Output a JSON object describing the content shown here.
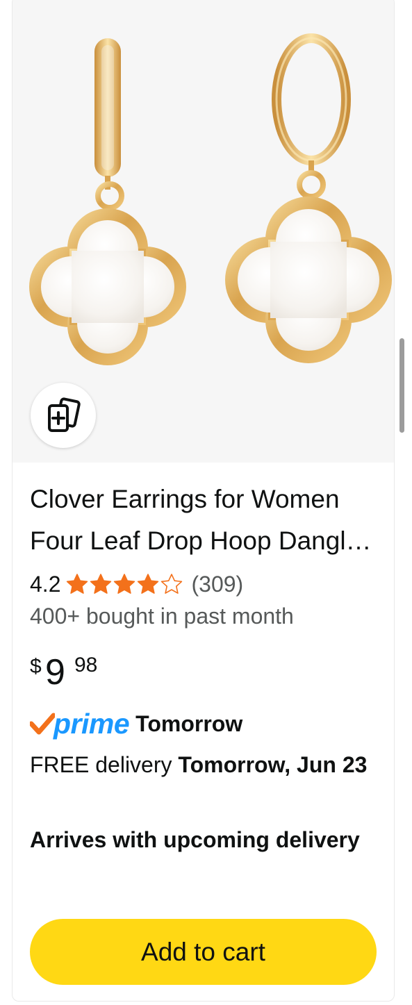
{
  "product": {
    "image_icon": "clover-earrings-image",
    "compare_icon": "add-to-compare-icon",
    "title": "Clover Earrings for Women Four Leaf Drop Hoop Dangle Earrings Gold Plated",
    "rating": "4.2",
    "rating_value": 4.2,
    "rating_max": 5,
    "star_color": "#f3711b",
    "review_count": "(309)",
    "bought": "400+ bought in past month",
    "price": {
      "symbol": "$",
      "whole": "9",
      "fraction": "98"
    }
  },
  "prime": {
    "logo_text": "prime",
    "check_color": "#f3711b",
    "logo_color": "#1a98ff",
    "day": "Tomorrow"
  },
  "delivery": {
    "prefix": "FREE delivery ",
    "date": "Tomorrow, Jun 23"
  },
  "arrives": "Arrives with upcoming delivery",
  "add_to_cart": {
    "label": "Add to cart",
    "color": "#ffd814"
  }
}
